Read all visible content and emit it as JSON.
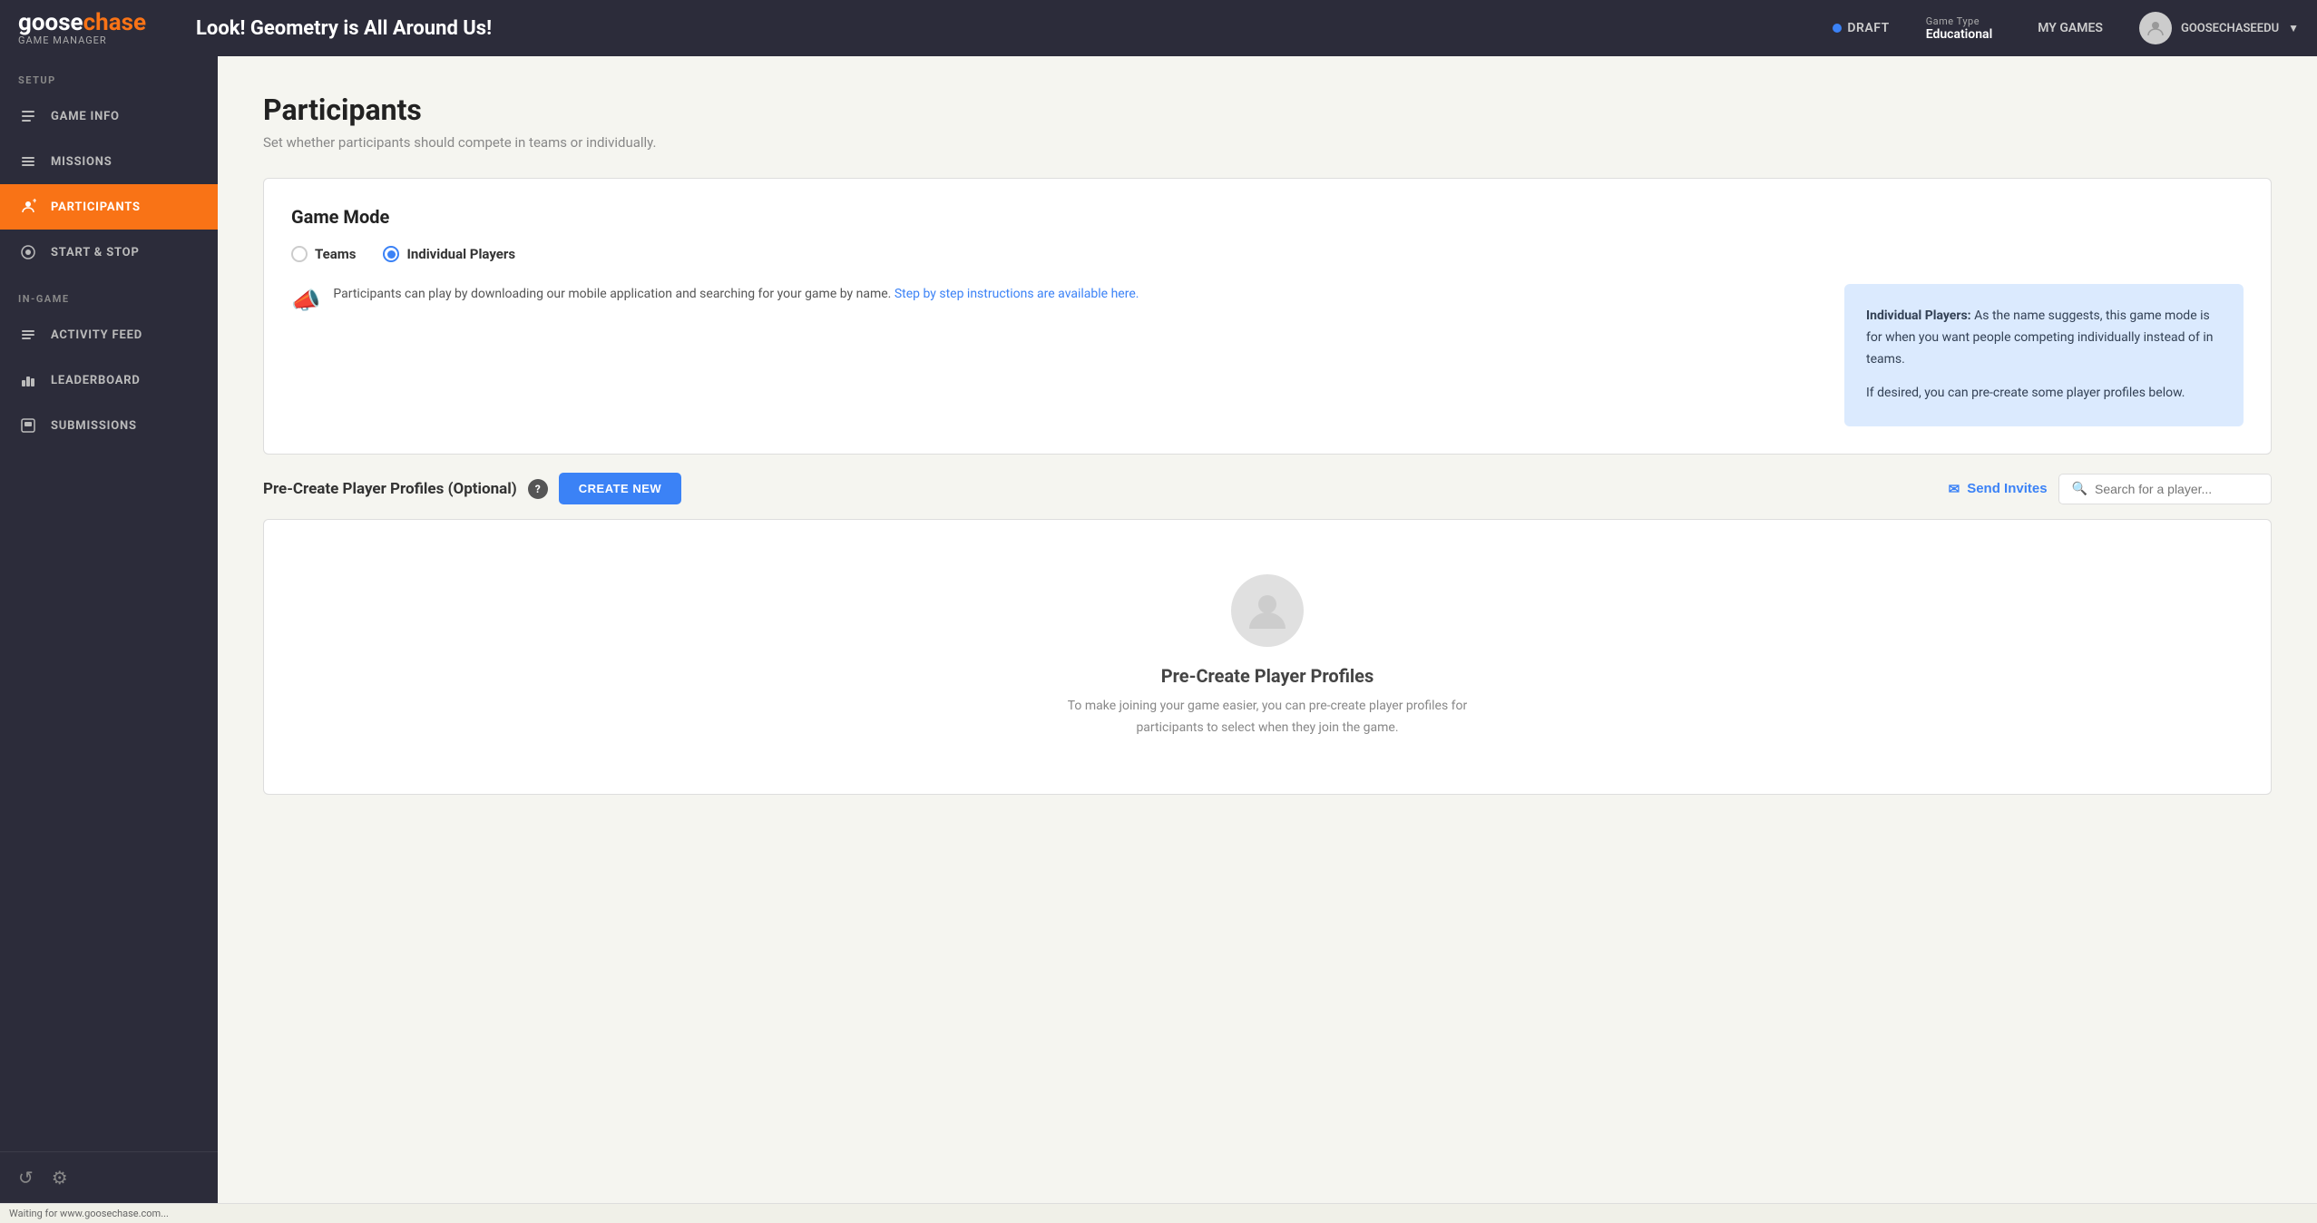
{
  "topNav": {
    "logoGoose": "goose",
    "logoChase": "chase",
    "logoSub": "Game Manager",
    "gameTitle": "Look! Geometry is All Around Us!",
    "draftLabel": "DRAFT",
    "gameTypeLabel": "Game Type",
    "gameTypeValue": "Educational",
    "myGamesLabel": "MY GAMES",
    "userName": "GOOSECHASEEDU"
  },
  "sidebar": {
    "setupLabel": "Setup",
    "inGameLabel": "In-Game",
    "items": [
      {
        "id": "game-info",
        "label": "GAME INFO",
        "icon": "☰"
      },
      {
        "id": "missions",
        "label": "MISSIONS",
        "icon": "≡"
      },
      {
        "id": "participants",
        "label": "PARTICIPANTS",
        "icon": "+"
      },
      {
        "id": "start-stop",
        "label": "START & STOP",
        "icon": "⏱"
      },
      {
        "id": "activity-feed",
        "label": "ACTIVITY FEED",
        "icon": "☰"
      },
      {
        "id": "leaderboard",
        "label": "LEADERBOARD",
        "icon": "📊"
      },
      {
        "id": "submissions",
        "label": "SUBMISSIONS",
        "icon": "🖼"
      }
    ]
  },
  "page": {
    "title": "Participants",
    "subtitle": "Set whether participants should compete in teams or individually.",
    "gameModeTitle": "Game Mode",
    "radioTeams": "Teams",
    "radioIndividual": "Individual Players",
    "infoText1": "Participants can play by downloading our mobile application and searching for your game by name.",
    "infoLinkText": "Step by step instructions are available here.",
    "tooltipTitle": "Individual Players:",
    "tooltipDesc1": "As the name suggests, this game mode is for when you want people competing individually instead of in teams.",
    "tooltipDesc2": "If desired, you can pre-create some player profiles below.",
    "preCreateTitle": "Pre-Create Player Profiles (Optional)",
    "helpIconLabel": "?",
    "createNewLabel": "CREATE NEW",
    "sendInvitesLabel": "Send Invites",
    "searchPlaceholder": "Search for a player...",
    "emptyStateTitle": "Pre-Create Player Profiles",
    "emptyStateDesc": "To make joining your game easier, you can pre-create player profiles for participants to select when they join the game."
  },
  "statusBar": {
    "text": "Waiting for www.goosechase.com..."
  }
}
